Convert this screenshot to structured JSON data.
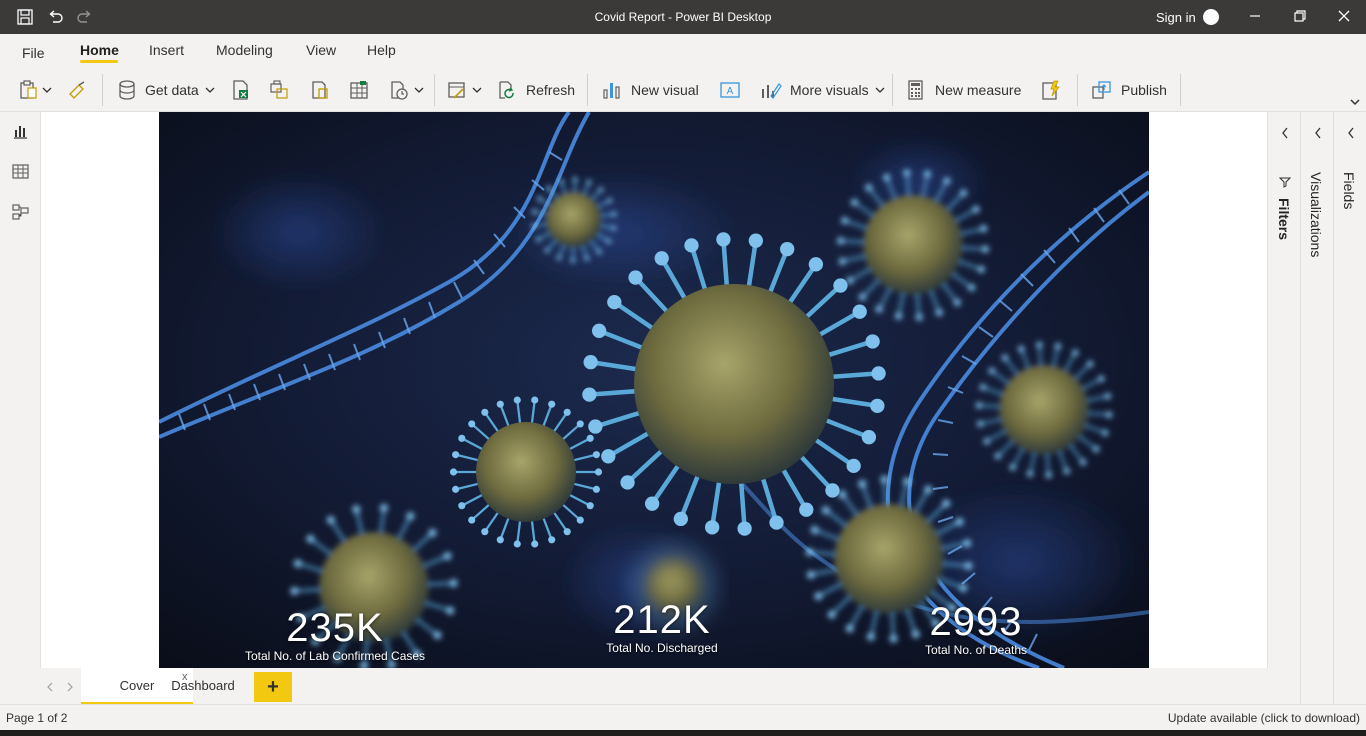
{
  "window": {
    "title": "Covid Report - Power BI Desktop",
    "sign_in": "Sign in"
  },
  "menu": {
    "file": "File",
    "home": "Home",
    "insert": "Insert",
    "modeling": "Modeling",
    "view": "View",
    "help": "Help"
  },
  "ribbon": {
    "get_data": "Get data",
    "refresh": "Refresh",
    "new_visual": "New visual",
    "more_visuals": "More visuals",
    "new_measure": "New measure",
    "publish": "Publish"
  },
  "report": {
    "kpis": [
      {
        "value": "235K",
        "label": "Total No. of Lab Confirmed Cases"
      },
      {
        "value": "212K",
        "label": "Total No. Discharged"
      },
      {
        "value": "2993",
        "label": "Total No. of Deaths"
      }
    ]
  },
  "panes": {
    "filters": "Filters",
    "visualizations": "Visualizations",
    "fields": "Fields"
  },
  "tabs": {
    "cover": "Cover",
    "cover_close": "x",
    "dashboard": "Dashboard",
    "add": "+"
  },
  "status": {
    "page": "Page 1 of 2",
    "update": "Update available (click to download)"
  },
  "colors": {
    "accent": "#f2c811",
    "titlebar": "#3b3a39",
    "report_bg": "#121623",
    "virus_body": "#7d7a4a",
    "virus_spike": "#5aa8d8",
    "dna": "#3f7fd6"
  }
}
